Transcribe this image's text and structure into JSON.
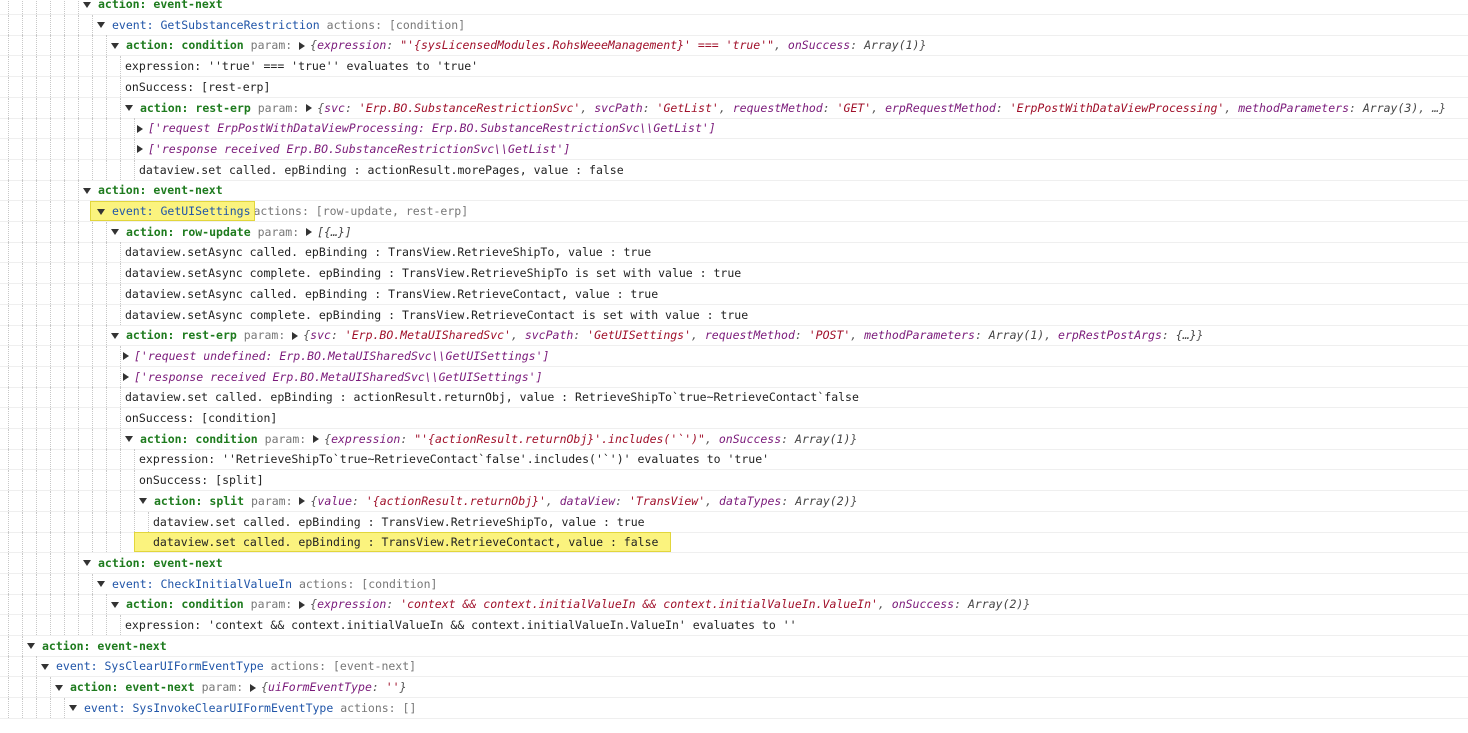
{
  "rows": [
    {
      "type": "action",
      "depth": 6,
      "expanded": true,
      "label": "action:",
      "value": "event-next"
    },
    {
      "type": "event",
      "depth": 7,
      "expanded": true,
      "label": "event:",
      "name": "GetSubstanceRestriction",
      "meta": "actions: [condition]"
    },
    {
      "type": "action-param",
      "depth": 8,
      "expanded": true,
      "label": "action:",
      "value": "condition",
      "param": "param:",
      "obj": [
        [
          "k",
          "expression"
        ],
        [
          "p",
          ": "
        ],
        [
          "s",
          "\"'{sysLicensedModules.RohsWeeeManagement}' === 'true'\""
        ],
        [
          "p",
          ", "
        ],
        [
          "k",
          "onSuccess"
        ],
        [
          "p",
          ": "
        ],
        [
          "a",
          "Array(1)"
        ],
        [
          "p",
          "}"
        ]
      ]
    },
    {
      "type": "text",
      "depth": 9,
      "text": "expression: ''true' === 'true'' evaluates to 'true'"
    },
    {
      "type": "text",
      "depth": 9,
      "text": "onSuccess:  [rest-erp]"
    },
    {
      "type": "action-param",
      "depth": 9,
      "expanded": true,
      "label": "action:",
      "value": "rest-erp",
      "param": "param:",
      "obj": [
        [
          "k",
          "svc"
        ],
        [
          "p",
          ": "
        ],
        [
          "s",
          "'Erp.BO.SubstanceRestrictionSvc'"
        ],
        [
          "p",
          ", "
        ],
        [
          "k",
          "svcPath"
        ],
        [
          "p",
          ": "
        ],
        [
          "s",
          "'GetList'"
        ],
        [
          "p",
          ", "
        ],
        [
          "k",
          "requestMethod"
        ],
        [
          "p",
          ": "
        ],
        [
          "s",
          "'GET'"
        ],
        [
          "p",
          ", "
        ],
        [
          "k",
          "erpRequestMethod"
        ],
        [
          "p",
          ": "
        ],
        [
          "s",
          "'ErpPostWithDataViewProcessing'"
        ],
        [
          "p",
          ", "
        ],
        [
          "k",
          "methodParameters"
        ],
        [
          "p",
          ": "
        ],
        [
          "a",
          "Array(3)"
        ],
        [
          "p",
          ", …}"
        ]
      ]
    },
    {
      "type": "collapsed",
      "depth": 10,
      "text": "['request ErpPostWithDataViewProcessing: Erp.BO.SubstanceRestrictionSvc\\\\GetList']"
    },
    {
      "type": "collapsed",
      "depth": 10,
      "text": "['response received Erp.BO.SubstanceRestrictionSvc\\\\GetList']"
    },
    {
      "type": "text",
      "depth": 10,
      "text": "dataview.set called. epBinding : actionResult.morePages, value : false"
    },
    {
      "type": "action",
      "depth": 6,
      "expanded": true,
      "label": "action:",
      "value": "event-next"
    },
    {
      "type": "event",
      "depth": 7,
      "expanded": true,
      "label": "event:",
      "name": "GetUISettings",
      "meta": "actions: [row-update, rest-erp]",
      "highlight": true
    },
    {
      "type": "action-param",
      "depth": 8,
      "expanded": true,
      "label": "action:",
      "value": "row-update",
      "param": "param:",
      "obj": [
        [
          "a",
          "[{…}]"
        ]
      ],
      "noBrace": true
    },
    {
      "type": "text",
      "depth": 9,
      "text": "dataview.setAsync called. epBinding : TransView.RetrieveShipTo, value : true"
    },
    {
      "type": "text",
      "depth": 9,
      "text": "dataview.setAsync complete. epBinding : TransView.RetrieveShipTo is set with value : true"
    },
    {
      "type": "text",
      "depth": 9,
      "text": "dataview.setAsync called. epBinding : TransView.RetrieveContact, value : true"
    },
    {
      "type": "text",
      "depth": 9,
      "text": "dataview.setAsync complete. epBinding : TransView.RetrieveContact is set with value : true"
    },
    {
      "type": "action-param",
      "depth": 8,
      "expanded": true,
      "label": "action:",
      "value": "rest-erp",
      "param": "param:",
      "obj": [
        [
          "k",
          "svc"
        ],
        [
          "p",
          ": "
        ],
        [
          "s",
          "'Erp.BO.MetaUISharedSvc'"
        ],
        [
          "p",
          ", "
        ],
        [
          "k",
          "svcPath"
        ],
        [
          "p",
          ": "
        ],
        [
          "s",
          "'GetUISettings'"
        ],
        [
          "p",
          ", "
        ],
        [
          "k",
          "requestMethod"
        ],
        [
          "p",
          ": "
        ],
        [
          "s",
          "'POST'"
        ],
        [
          "p",
          ", "
        ],
        [
          "k",
          "methodParameters"
        ],
        [
          "p",
          ": "
        ],
        [
          "a",
          "Array(1)"
        ],
        [
          "p",
          ", "
        ],
        [
          "k",
          "erpRestPostArgs"
        ],
        [
          "p",
          ": "
        ],
        [
          "a",
          "{…}"
        ],
        [
          "p",
          "}"
        ]
      ]
    },
    {
      "type": "collapsed",
      "depth": 9,
      "text": "['request undefined: Erp.BO.MetaUISharedSvc\\\\GetUISettings']"
    },
    {
      "type": "collapsed",
      "depth": 9,
      "text": "['response received Erp.BO.MetaUISharedSvc\\\\GetUISettings']"
    },
    {
      "type": "text",
      "depth": 9,
      "text": "dataview.set called. epBinding : actionResult.returnObj, value : RetrieveShipTo`true~RetrieveContact`false"
    },
    {
      "type": "text",
      "depth": 9,
      "text": "onSuccess:  [condition]"
    },
    {
      "type": "action-param",
      "depth": 9,
      "expanded": true,
      "label": "action:",
      "value": "condition",
      "param": "param:",
      "obj": [
        [
          "k",
          "expression"
        ],
        [
          "p",
          ": "
        ],
        [
          "s",
          "\"'{actionResult.returnObj}'.includes('`')\""
        ],
        [
          "p",
          ", "
        ],
        [
          "k",
          "onSuccess"
        ],
        [
          "p",
          ": "
        ],
        [
          "a",
          "Array(1)"
        ],
        [
          "p",
          "}"
        ]
      ]
    },
    {
      "type": "text",
      "depth": 10,
      "text": "expression: ''RetrieveShipTo`true~RetrieveContact`false'.includes('`')' evaluates to 'true'"
    },
    {
      "type": "text",
      "depth": 10,
      "text": "onSuccess:  [split]"
    },
    {
      "type": "action-param",
      "depth": 10,
      "expanded": true,
      "label": "action:",
      "value": "split",
      "param": "param:",
      "obj": [
        [
          "k",
          "value"
        ],
        [
          "p",
          ": "
        ],
        [
          "s",
          "'{actionResult.returnObj}'"
        ],
        [
          "p",
          ", "
        ],
        [
          "k",
          "dataView"
        ],
        [
          "p",
          ": "
        ],
        [
          "s",
          "'TransView'"
        ],
        [
          "p",
          ", "
        ],
        [
          "k",
          "dataTypes"
        ],
        [
          "p",
          ": "
        ],
        [
          "a",
          "Array(2)"
        ],
        [
          "p",
          "}"
        ]
      ]
    },
    {
      "type": "text",
      "depth": 11,
      "text": "dataview.set called. epBinding : TransView.RetrieveShipTo, value : true"
    },
    {
      "type": "text",
      "depth": 11,
      "text": "dataview.set called. epBinding : TransView.RetrieveContact, value : false",
      "highlight": true
    },
    {
      "type": "action",
      "depth": 6,
      "expanded": true,
      "label": "action:",
      "value": "event-next"
    },
    {
      "type": "event",
      "depth": 7,
      "expanded": true,
      "label": "event:",
      "name": "CheckInitialValueIn",
      "meta": "actions: [condition]"
    },
    {
      "type": "action-param",
      "depth": 8,
      "expanded": true,
      "label": "action:",
      "value": "condition",
      "param": "param:",
      "obj": [
        [
          "k",
          "expression"
        ],
        [
          "p",
          ": "
        ],
        [
          "s",
          "'context && context.initialValueIn && context.initialValueIn.ValueIn'"
        ],
        [
          "p",
          ", "
        ],
        [
          "k",
          "onSuccess"
        ],
        [
          "p",
          ": "
        ],
        [
          "a",
          "Array(2)"
        ],
        [
          "p",
          "}"
        ]
      ]
    },
    {
      "type": "text",
      "depth": 9,
      "text": "expression: 'context && context.initialValueIn && context.initialValueIn.ValueIn' evaluates to ''"
    },
    {
      "type": "action",
      "depth": 2,
      "expanded": true,
      "label": "action:",
      "value": "event-next"
    },
    {
      "type": "event",
      "depth": 3,
      "expanded": true,
      "label": "event:",
      "name": "SysClearUIFormEventType",
      "meta": "actions: [event-next]"
    },
    {
      "type": "action-param",
      "depth": 4,
      "expanded": true,
      "label": "action:",
      "value": "event-next",
      "param": "param:",
      "obj": [
        [
          "k",
          "uiFormEventType"
        ],
        [
          "p",
          ": "
        ],
        [
          "s",
          "''"
        ],
        [
          "p",
          "}"
        ]
      ]
    },
    {
      "type": "event",
      "depth": 5,
      "expanded": true,
      "label": "event:",
      "name": "SysInvokeClearUIFormEventType",
      "meta": "actions: []"
    }
  ]
}
